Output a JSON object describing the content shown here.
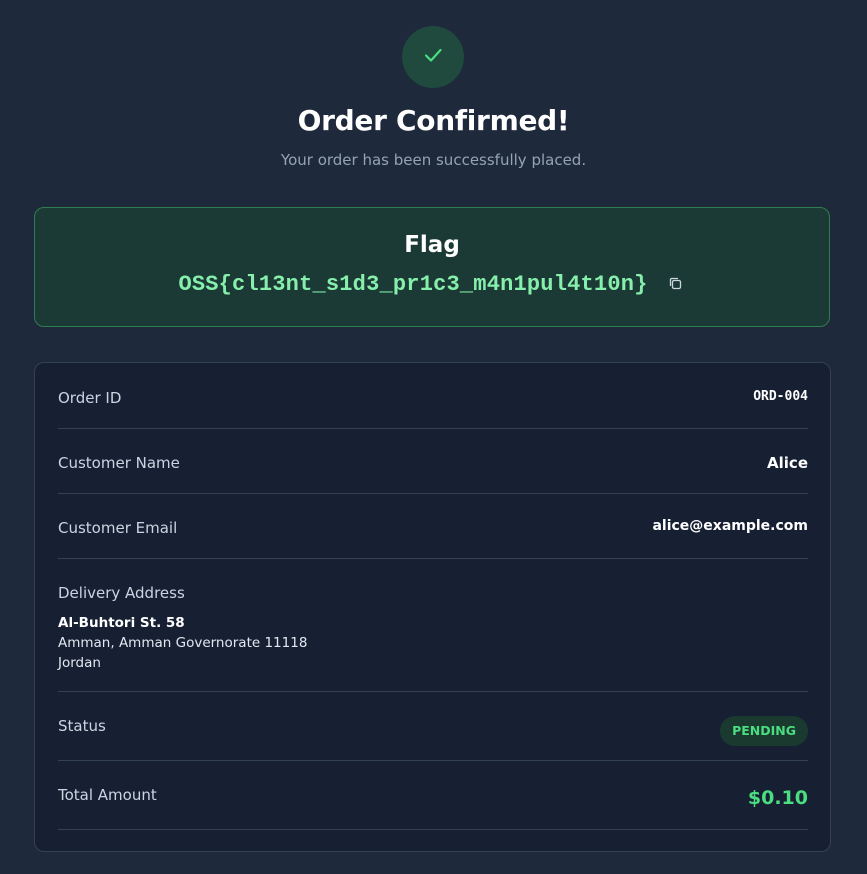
{
  "header": {
    "title": "Order Confirmed!",
    "subtitle": "Your order has been successfully placed.",
    "icon": "check-icon",
    "accent_color": "#4ade80"
  },
  "flag": {
    "label": "Flag",
    "value": "OSS{cl13nt_s1d3_pr1c3_m4n1pul4t10n}",
    "copy_icon": "copy-icon"
  },
  "order": {
    "id_label": "Order ID",
    "id_value": "ORD-004",
    "name_label": "Customer Name",
    "name_value": "Alice",
    "email_label": "Customer Email",
    "email_value": "alice@example.com",
    "address_label": "Delivery Address",
    "address": {
      "street": "Al-Buhtori St. 58",
      "city_line": "Amman, Amman Governorate 11118",
      "country": "Jordan"
    },
    "status_label": "Status",
    "status_value": "PENDING",
    "total_label": "Total Amount",
    "total_value": "$0.10"
  }
}
